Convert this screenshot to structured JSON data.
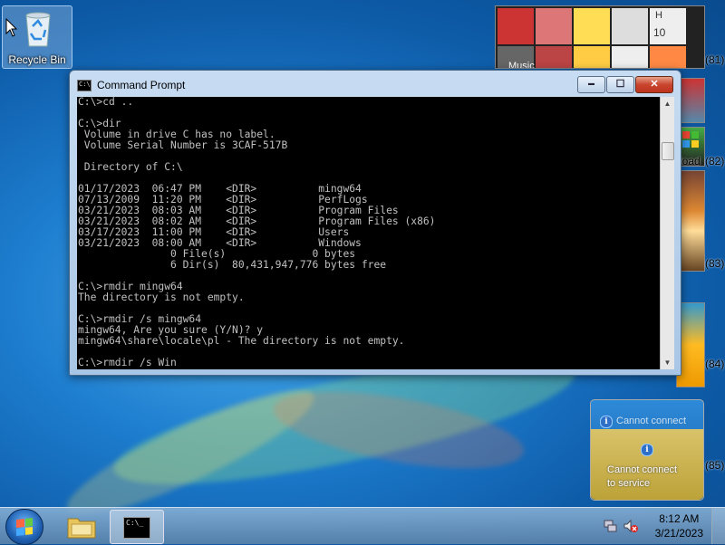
{
  "desktop": {
    "recycle_bin_label": "Recycle Bin"
  },
  "command_prompt": {
    "title": "Command Prompt",
    "icon_text": "C:\\",
    "console_lines": [
      "C:\\>cd ..",
      "",
      "C:\\>dir",
      " Volume in drive C has no label.",
      " Volume Serial Number is 3CAF-517B",
      "",
      " Directory of C:\\",
      "",
      "01/17/2023  06:47 PM    <DIR>          mingw64",
      "07/13/2009  11:20 PM    <DIR>          PerfLogs",
      "03/21/2023  08:03 AM    <DIR>          Program Files",
      "03/21/2023  08:02 AM    <DIR>          Program Files (x86)",
      "03/17/2023  11:00 PM    <DIR>          Users",
      "03/21/2023  08:00 AM    <DIR>          Windows",
      "               0 File(s)              0 bytes",
      "               6 Dir(s)  80,431,947,776 bytes free",
      "",
      "C:\\>rmdir mingw64",
      "The directory is not empty.",
      "",
      "C:\\>rmdir /s mingw64",
      "mingw64, Are you sure (Y/N)? y",
      "mingw64\\share\\locale\\pl - The directory is not empty.",
      "",
      "C:\\>rmdir /s Win"
    ],
    "buttons": {
      "minimize": "▬",
      "maximize": "☐",
      "close": "✕"
    }
  },
  "gadgets": {
    "photo_caption": "Music",
    "calendar_text": "H",
    "calendar_num": "10",
    "side_numbers": [
      "(81)",
      "(82)",
      "(83)",
      "(84)",
      "(85)"
    ],
    "side_text_82": "load",
    "cannot_connect_title": "Cannot connect",
    "cannot_connect_msg": "Cannot connect\nto service"
  },
  "taskbar": {
    "clock_time": "8:12 AM",
    "clock_date": "3/21/2023",
    "cmd_icon_text": "C:\\_"
  },
  "colors": {
    "desktop_blue": "#1e7ed0",
    "console_bg": "#000000",
    "console_fg": "#c0c0c0",
    "close_red": "#c8452e"
  }
}
